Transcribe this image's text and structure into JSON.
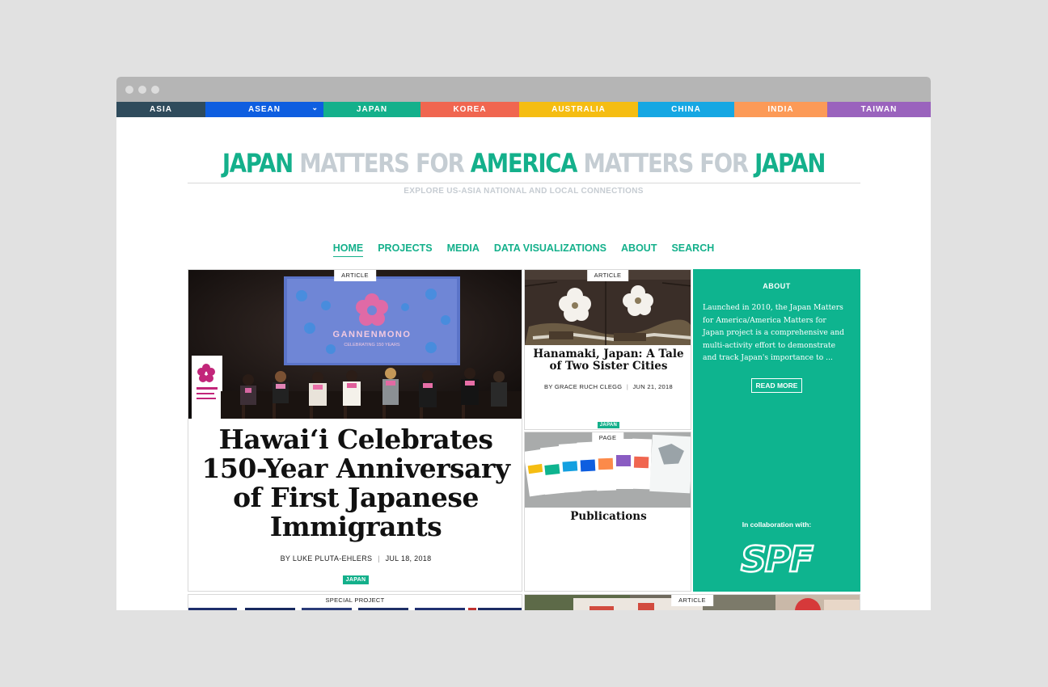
{
  "regions": [
    {
      "label": "ASIA",
      "color": "#2f4b5c"
    },
    {
      "label": "ASEAN",
      "color": "#0e5ee0"
    },
    {
      "label": "JAPAN",
      "color": "#14b08b"
    },
    {
      "label": "KOREA",
      "color": "#f06650"
    },
    {
      "label": "AUSTRALIA",
      "color": "#f5bd12"
    },
    {
      "label": "CHINA",
      "color": "#16a7e3"
    },
    {
      "label": "INDIA",
      "color": "#fc9a57"
    },
    {
      "label": "TAIWAN",
      "color": "#9a63bd"
    }
  ],
  "header": {
    "title_parts": [
      "JAPAN",
      "MATTERS FOR",
      "AMERICA",
      "MATTERS FOR",
      "JAPAN"
    ],
    "tagline": "EXPLORE US-ASIA NATIONAL AND LOCAL CONNECTIONS"
  },
  "nav": [
    "HOME",
    "PROJECTS",
    "MEDIA",
    "DATA VISUALIZATIONS",
    "ABOUT",
    "SEARCH"
  ],
  "main_article": {
    "label": "ARTICLE",
    "image_text": {
      "brand": "GANNENMONO",
      "sub": "CELEBRATING 150 YEARS"
    },
    "title": "Hawai‘i Celebrates 150-Year Anniversary of First Japanese Immigrants",
    "author": "BY LUKE PLUTA-EHLERS",
    "date": "JUL 18, 2018",
    "tag": "JAPAN"
  },
  "side_article": {
    "label": "ARTICLE",
    "title": "Hanamaki, Japan: A Tale of Two Sister Cities",
    "author": "BY GRACE RUCH CLEGG",
    "date": "JUN 21, 2018",
    "tag": "JAPAN"
  },
  "page_card": {
    "label": "PAGE",
    "title": "Publications"
  },
  "about": {
    "heading": "ABOUT",
    "text": "Launched in 2010, the Japan Matters for America/America Matters for Japan project is a comprehensive and multi-activity effort to demonstrate and track Japan's importance to ...",
    "button": "READ MORE",
    "collab": "In collaboration with:",
    "logo": "SPF"
  },
  "bottom_left": {
    "label": "SPECIAL PROJECT"
  },
  "bottom_right": {
    "label": "ARTICLE"
  }
}
